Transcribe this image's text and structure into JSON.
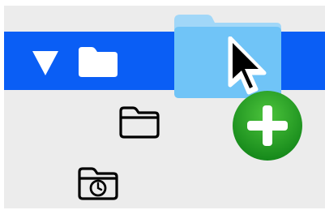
{
  "window": {
    "title": ""
  },
  "outline": {
    "rows": [
      {
        "kind": "expanded-folder",
        "selected": true,
        "disclosure_icon": "disclosure-triangle-down-icon",
        "folder_icon": "folder-icon-filled-white",
        "label": ""
      },
      {
        "kind": "child-folder",
        "selected": false,
        "folder_icon": "folder-outline-icon",
        "label": ""
      },
      {
        "kind": "recents-folder",
        "selected": false,
        "folder_icon": "folder-clock-icon",
        "label": ""
      }
    ]
  },
  "drag_operation": {
    "ghost_icon": "folder-drag-ghost-icon",
    "cursor_icon": "arrow-cursor-icon",
    "badge_icon": "copy-plus-badge-icon"
  },
  "colors": {
    "background": "#ececec",
    "selection": "#0a5ef5",
    "selection_foreground": "#ffffff",
    "folder_stroke": "#000000",
    "ghost_folder": "#6ec3f7",
    "copy_badge": "#1f9b1f"
  }
}
